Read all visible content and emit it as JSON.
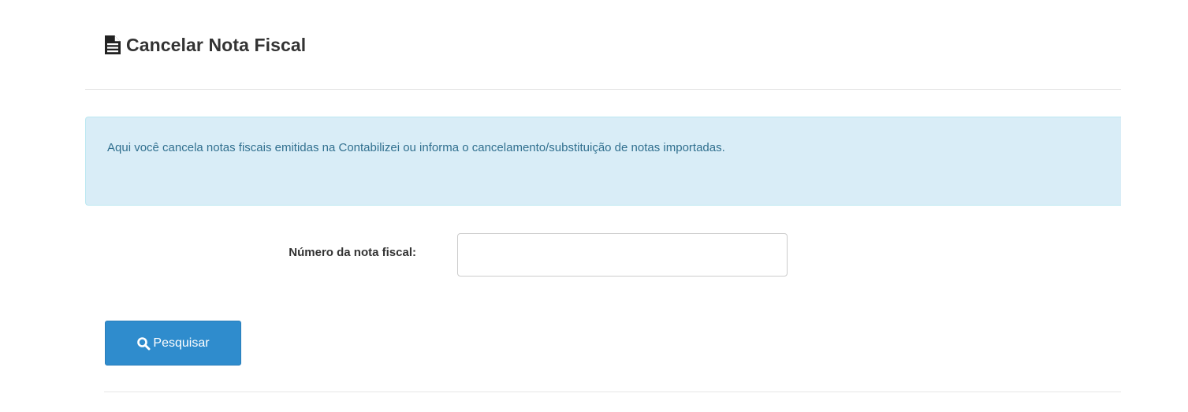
{
  "header": {
    "title": "Cancelar Nota Fiscal",
    "icon": "document-icon"
  },
  "info": {
    "text": "Aqui você cancela notas fiscais emitidas na Contabilizei ou informa o cancelamento/substituição de notas importadas."
  },
  "form": {
    "invoice_number_label": "Número da nota fiscal:",
    "invoice_number_value": "",
    "invoice_number_placeholder": ""
  },
  "actions": {
    "search_label": "Pesquisar",
    "search_icon": "search-icon"
  },
  "colors": {
    "info_background": "#d9edf7",
    "info_text": "#31708f",
    "primary_button": "#2f8ccd"
  }
}
